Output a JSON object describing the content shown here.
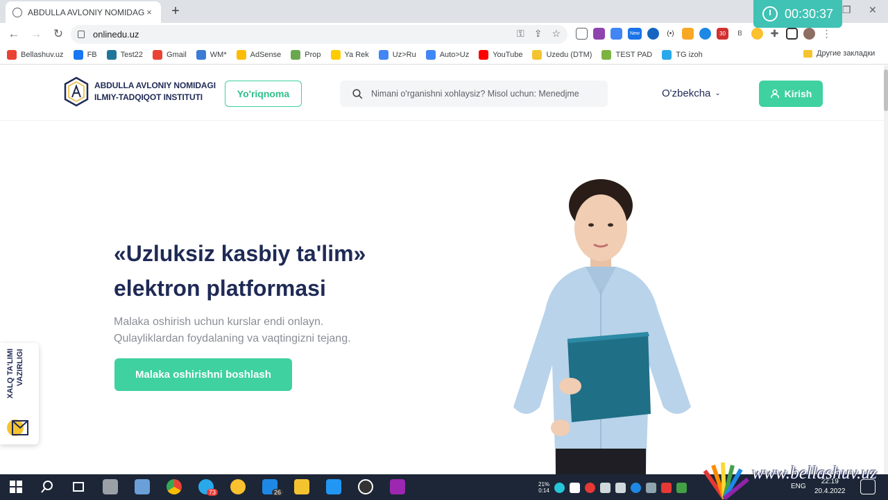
{
  "browser": {
    "tab_title": "ABDULLA AVLONIY NOMIDAGI X",
    "tab_close": "×",
    "new_tab": "+",
    "url": "onlinedu.uz",
    "timer": "00:30:37",
    "ext_badge_new": "New",
    "ext_badge_count": "30",
    "ext_b": "B"
  },
  "bookmarks": [
    {
      "label": "Bellashuv.uz",
      "color": "#e94235"
    },
    {
      "label": "FB",
      "color": "#1877f2"
    },
    {
      "label": "Test22",
      "color": "#21759b"
    },
    {
      "label": "Gmail",
      "color": "#ea4335"
    },
    {
      "label": "WM*",
      "color": "#3a7bd5"
    },
    {
      "label": "AdSense",
      "color": "#fbbc04"
    },
    {
      "label": "Prop",
      "color": "#6aa84f"
    },
    {
      "label": "Ya Rek",
      "color": "#ffcc00"
    },
    {
      "label": "Uz>Ru",
      "color": "#4285f4"
    },
    {
      "label": "Auto>Uz",
      "color": "#4285f4"
    },
    {
      "label": "YouTube",
      "color": "#ff0000"
    },
    {
      "label": "Uzedu (DTM)",
      "color": "#f4c430"
    },
    {
      "label": "TEST PAD",
      "color": "#7cb342"
    },
    {
      "label": "TG izoh",
      "color": "#29a9eb"
    }
  ],
  "bookmarks_more": "»",
  "bookmarks_other": "Другие закладки",
  "site": {
    "logo_line1": "ABDULLA AVLONIY NOMIDAGI",
    "logo_line2": "ILMIY-TADQIQOT INSTITUTI",
    "guide_button": "Yo'riqnoma",
    "search_placeholder": "Nimani o'rganishni xohlaysiz? Misol uchun: Menedjme",
    "language": "O'zbekcha",
    "login_button": "Kirish",
    "hero_title_line1": "«Uzluksiz kasbiy ta'lim»",
    "hero_title_line2": "elektron platformasi",
    "hero_sub_line1": "Malaka oshirish uchun kurslar endi onlayn.",
    "hero_sub_line2": "Qulayliklardan foydalaning va vaqtingizni tejang.",
    "cta_button": "Malaka oshirishni boshlash",
    "ministry_line1": "XALQ TA'LIMI",
    "ministry_line2": "VAZIRLIGI"
  },
  "taskbar": {
    "telegram_badge": "73",
    "files_badge": "26",
    "tray_temp": "21%",
    "tray_temp2": "0:14",
    "lang_indicator": "ENG",
    "time": "22:19",
    "date": "20.4.2022"
  },
  "watermark": "www.bellashuv.uz",
  "colors": {
    "accent": "#3fd1a0",
    "navy": "#1f2a55",
    "taskbar": "#1c2636"
  }
}
